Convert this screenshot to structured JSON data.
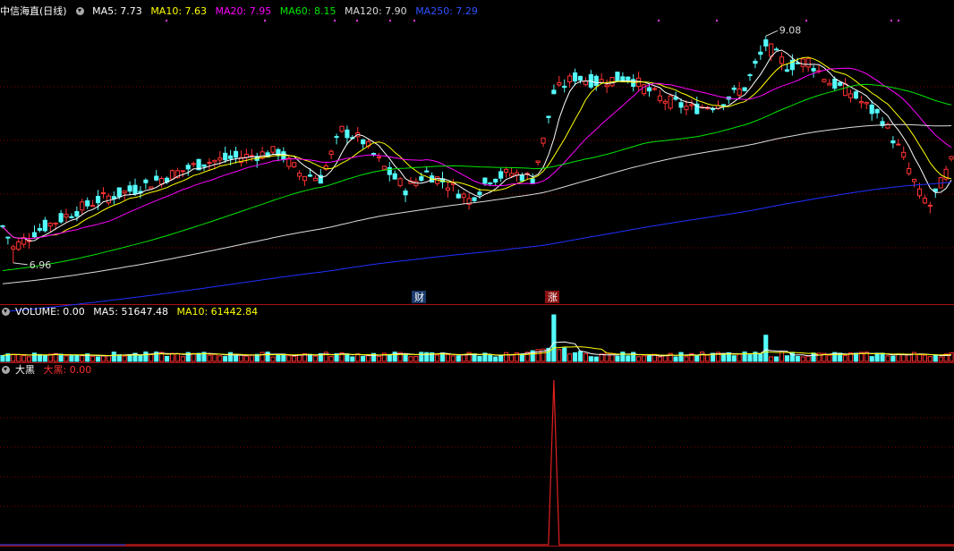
{
  "colors": {
    "up": "#ff3232",
    "down": "#54fcfc",
    "ma5": "#ffffff",
    "ma10": "#ffff00",
    "ma20": "#ff00ff",
    "ma60": "#00e600",
    "ma120": "#dcdcdc",
    "ma250": "#2030ff",
    "grid": "#8b0000",
    "border": "#b01010"
  },
  "price_panel": {
    "stock_name": "中信海直",
    "period": "(日线)",
    "ma5": "MA5: 7.73",
    "ma10": "MA10: 7.63",
    "ma20": "MA20: 7.95",
    "ma60": "MA60: 8.15",
    "ma120": "MA120: 7.90",
    "ma250": "MA250: 7.29",
    "low_label": "6.96",
    "high_label": "9.08",
    "marker_cai": "财",
    "marker_zhang": "涨"
  },
  "volume_panel": {
    "title": "VOLUME: 0.00",
    "ma5": "MA5: 51647.48",
    "ma10": "MA10: 61442.84"
  },
  "indicator_panel": {
    "name": "大黑",
    "label": "大黑: 0.00"
  },
  "chart_data": {
    "type": "candlestick",
    "ylim": [
      6.7,
      9.25
    ],
    "high": 9.08,
    "low": 6.96,
    "high_bar_index": 144,
    "low_bar_index": 2,
    "bars": 180,
    "ma_values": {
      "MA5": 7.73,
      "MA10": 7.63,
      "MA20": 7.95,
      "MA60": 8.15,
      "MA120": 7.9,
      "MA250": 7.29
    },
    "volume": {
      "ma5": 51647.48,
      "ma10": 61442.84,
      "spike_bar_index": 104
    },
    "indicator": {
      "name": "大黑",
      "last_value": 0.0,
      "spike_bar_index": 104
    }
  }
}
